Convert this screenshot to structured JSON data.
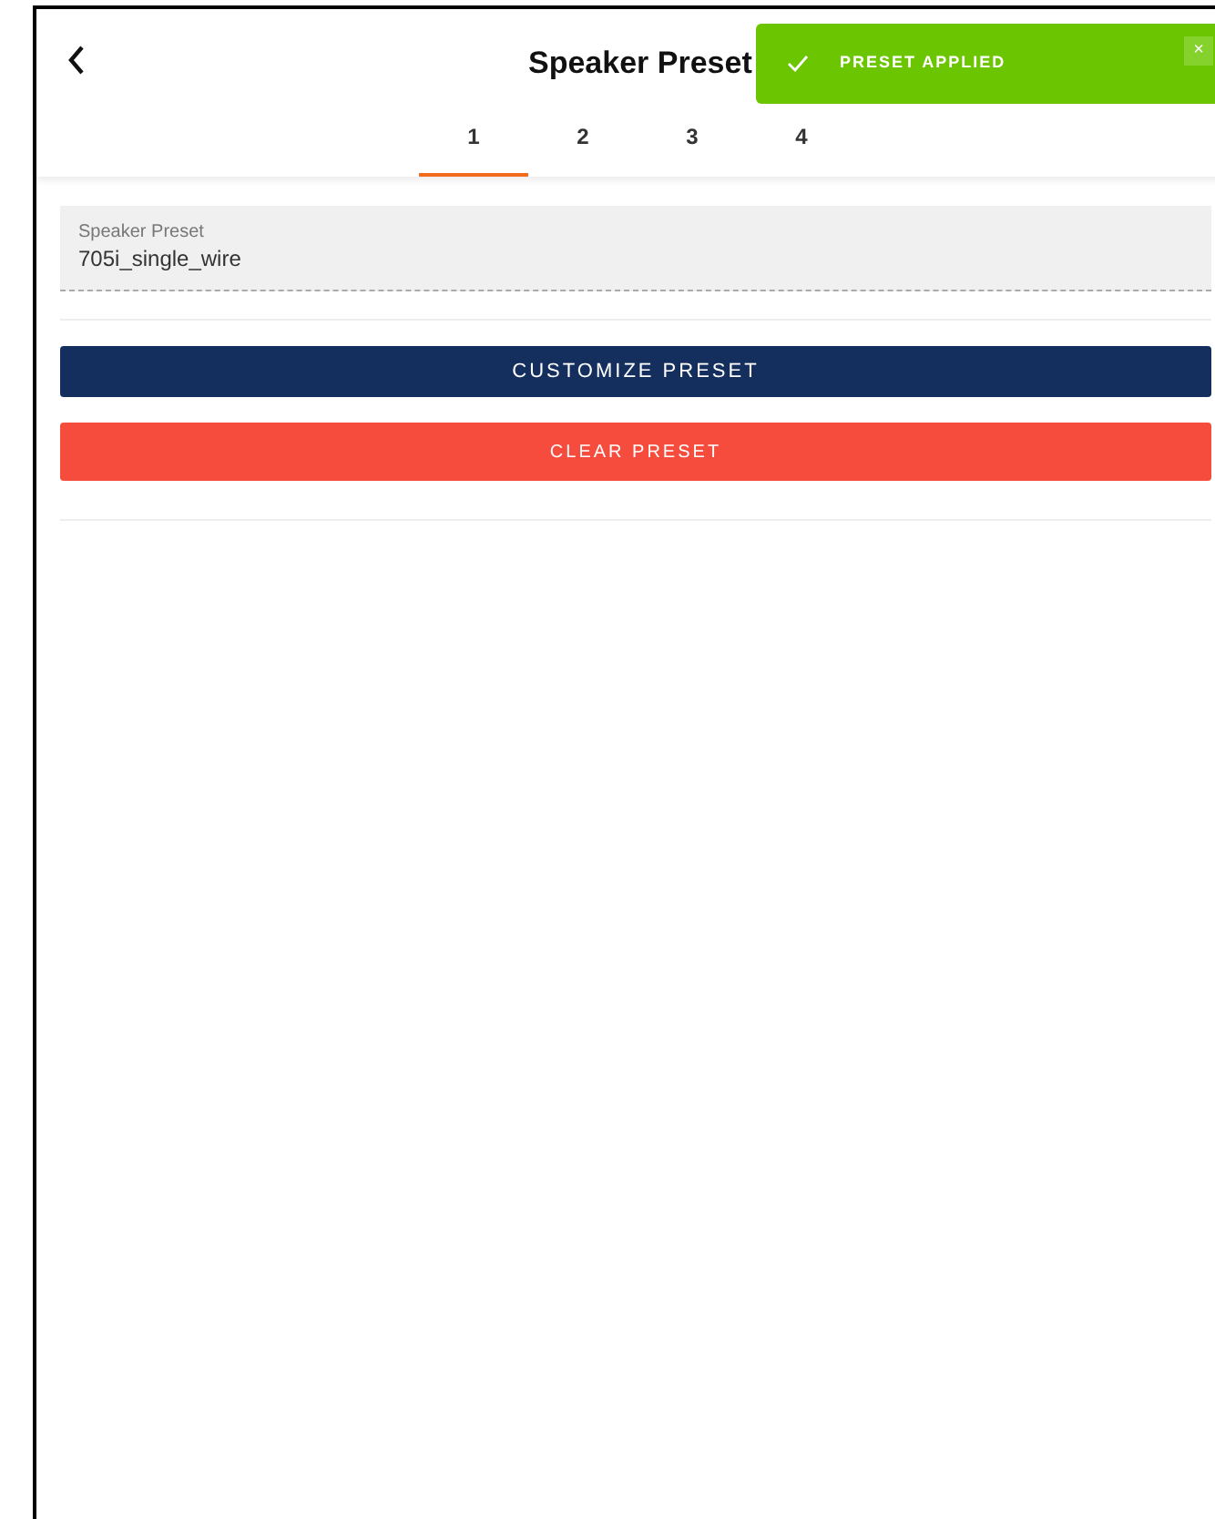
{
  "header": {
    "title": "Speaker Preset"
  },
  "tabs": [
    {
      "label": "1",
      "selected": true
    },
    {
      "label": "2",
      "selected": false
    },
    {
      "label": "3",
      "selected": false
    },
    {
      "label": "4",
      "selected": false
    }
  ],
  "preset_field": {
    "label": "Speaker Preset",
    "value": "705i_single_wire"
  },
  "buttons": [
    {
      "label": "CUSTOMIZE PRESET",
      "kind": "primary"
    },
    {
      "label": "CLEAR PRESET",
      "kind": "danger"
    }
  ],
  "toast": {
    "message": "PRESET APPLIED",
    "close": "×"
  }
}
